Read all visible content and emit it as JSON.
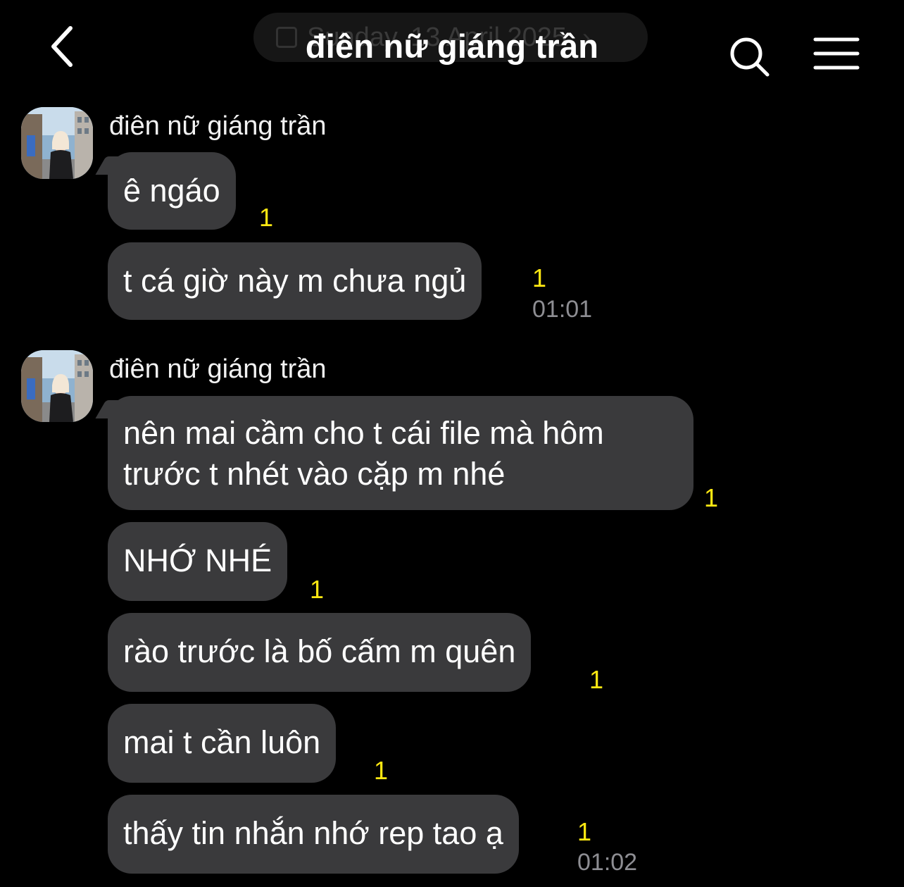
{
  "header": {
    "title": "điên nữ giáng trần",
    "date_pill": "Sunday, 13 April 2025"
  },
  "groups": [
    {
      "sender": "điên nữ giáng trần",
      "messages": [
        {
          "text": "ê ngáo",
          "unread": "1"
        },
        {
          "text": "t cá giờ này m chưa ngủ",
          "unread": "1",
          "time": "01:01"
        }
      ]
    },
    {
      "sender": "điên nữ giáng trần",
      "messages": [
        {
          "text_line1": "nên mai cầm cho t cái file mà hôm",
          "text_line2": "trước t nhét vào cặp m nhé",
          "unread": "1"
        },
        {
          "text": "NHỚ NHÉ",
          "unread": "1"
        },
        {
          "text": "rào trước là bố cấm m quên",
          "unread": "1"
        },
        {
          "text": "mai t cần luôn",
          "unread": "1"
        },
        {
          "text": "thấy tin nhắn nhớ rep tao ạ",
          "unread": "1",
          "time": "01:02"
        }
      ]
    }
  ],
  "colors": {
    "background": "#000000",
    "bubble": "#3a3a3c",
    "unread": "#ffe812",
    "time": "#8e8e93"
  },
  "icons": [
    "back-arrow-icon",
    "search-icon",
    "menu-icon",
    "calendar-icon",
    "avatar-photo"
  ]
}
